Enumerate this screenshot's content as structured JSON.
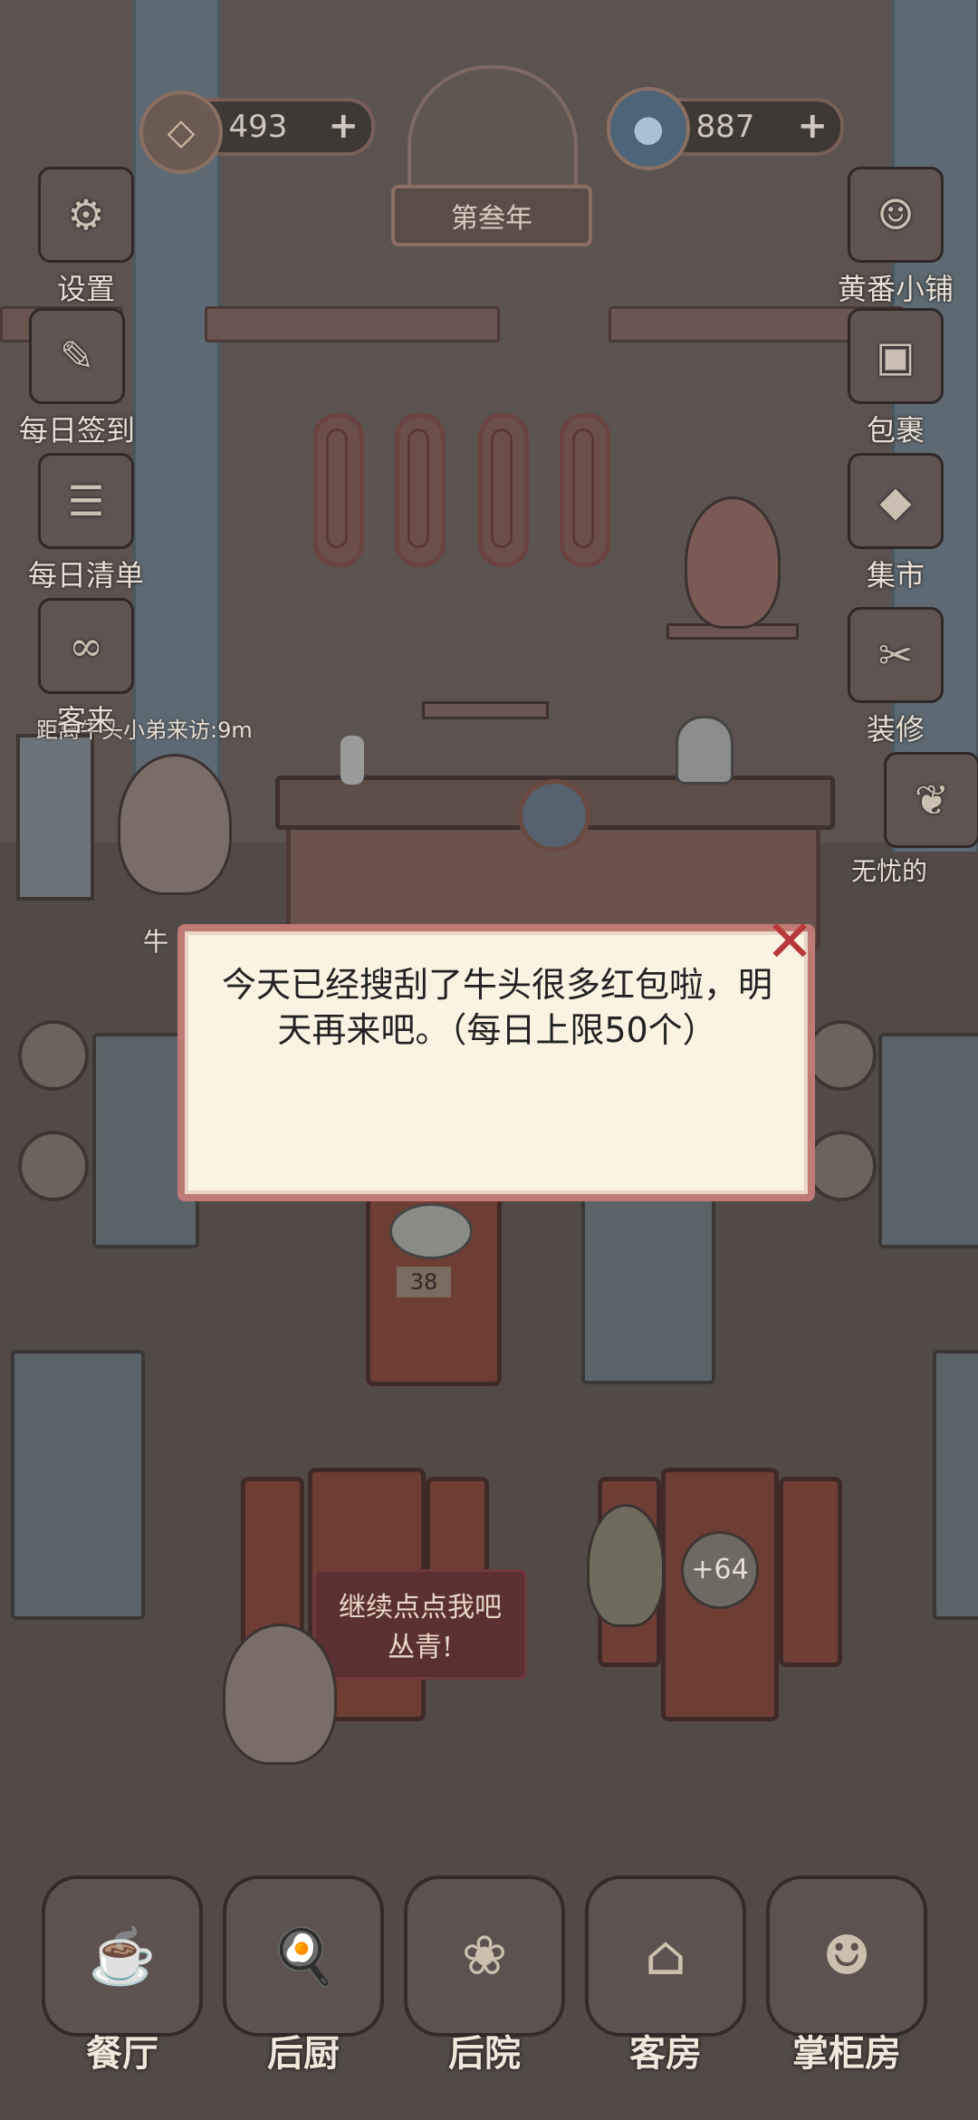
{
  "resources": {
    "coins": {
      "icon": "coin-icon",
      "value": "493"
    },
    "gourd": {
      "icon": "gourd-icon",
      "value": "887"
    }
  },
  "year_label": "第叁年",
  "left_menu": [
    {
      "label": "设置",
      "icon": "settings-icon",
      "glyph": "⚙"
    },
    {
      "label": "每日签到",
      "icon": "checkin-icon",
      "glyph": "✎"
    },
    {
      "label": "每日清单",
      "icon": "list-icon",
      "glyph": "☰"
    },
    {
      "label": "客来",
      "icon": "guest-icon",
      "glyph": "∞"
    }
  ],
  "right_menu": [
    {
      "label": "黄番小铺",
      "icon": "shop-icon",
      "glyph": "☺"
    },
    {
      "label": "包裹",
      "icon": "bag-icon",
      "glyph": "▣"
    },
    {
      "label": "集市",
      "icon": "market-icon",
      "glyph": "◆"
    },
    {
      "label": "装修",
      "icon": "decorate-icon",
      "glyph": "✂"
    },
    {
      "label": "无忧的",
      "icon": "carefree-icon",
      "glyph": "❦"
    }
  ],
  "visit_timer": "距离牛头小弟来访:9m",
  "ox_label": "牛",
  "dish_count": "38",
  "coin_popup": "+64",
  "speech_bubble": {
    "line1": "继续点点我吧",
    "line2": "丛青!"
  },
  "dialog": {
    "message": "今天已经搜刮了牛头很多红包啦，明天再来吧。（每日上限50个）"
  },
  "bottom_nav": [
    {
      "label": "餐厅",
      "icon": "dining-hall-icon",
      "glyph": "☕"
    },
    {
      "label": "后厨",
      "icon": "kitchen-icon",
      "glyph": "🍳"
    },
    {
      "label": "后院",
      "icon": "backyard-icon",
      "glyph": "❀"
    },
    {
      "label": "客房",
      "icon": "guest-room-icon",
      "glyph": "⌂"
    },
    {
      "label": "掌柜房",
      "icon": "manager-room-icon",
      "glyph": "☻"
    }
  ]
}
